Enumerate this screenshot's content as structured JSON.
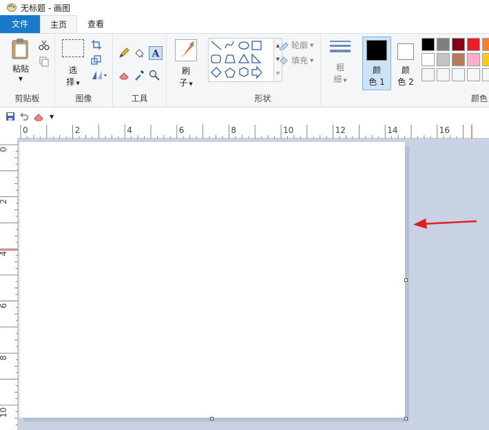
{
  "window": {
    "title": "无标题 - 画图"
  },
  "tabs": {
    "file": "文件",
    "home": "主页",
    "view": "查看"
  },
  "clipboard": {
    "paste": "粘贴",
    "label": "剪贴板"
  },
  "image": {
    "select_l1": "选",
    "select_l2": "择",
    "label": "图像"
  },
  "tools": {
    "label": "工具"
  },
  "brushes": {
    "l1": "刷",
    "l2": "子"
  },
  "shapes": {
    "outline": "轮廓",
    "fill": "填充",
    "label": "形状"
  },
  "size": {
    "l1": "粗",
    "l2": "细"
  },
  "color1": {
    "l1": "颜",
    "l2": "色 1",
    "value": "#000000"
  },
  "color2": {
    "l1": "颜",
    "l2": "色 2",
    "value": "#ffffff"
  },
  "colors": {
    "label": "颜色",
    "row1": [
      "#000000",
      "#7f7f7f",
      "#880015",
      "#ed1c24",
      "#ff7f27"
    ],
    "row2": [
      "#ffffff",
      "#c3c3c3",
      "#b97a57",
      "#ffaec9",
      "#ffc90e"
    ],
    "row3": [
      "",
      "",
      "",
      "",
      ""
    ]
  },
  "ruler": {
    "top": [
      "0",
      "2",
      "4",
      "6",
      "8",
      "10",
      "12",
      "14",
      "16"
    ],
    "left": [
      "0",
      "2",
      "4",
      "6",
      "8",
      "10"
    ]
  },
  "accent": "#1979ca",
  "annotation_color": "#e02020"
}
